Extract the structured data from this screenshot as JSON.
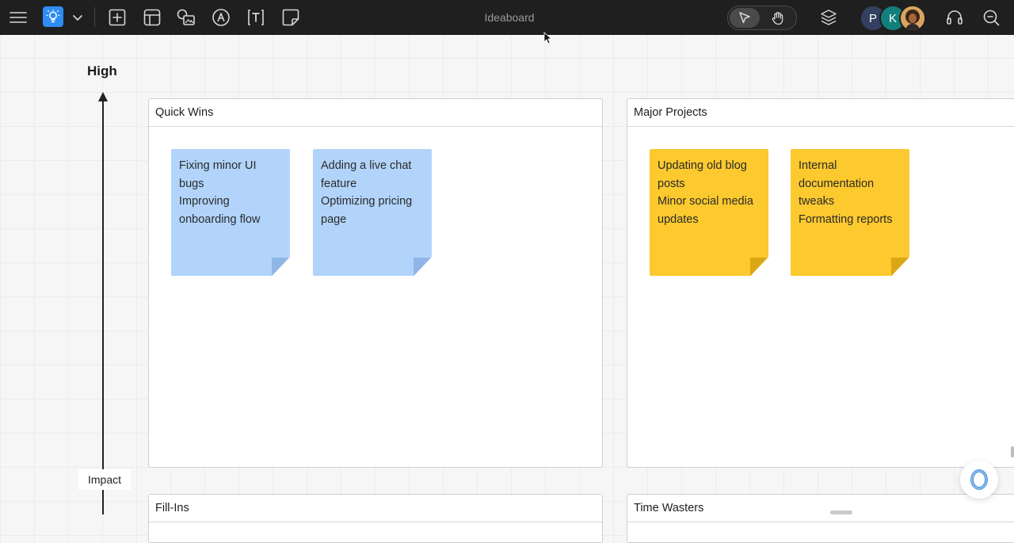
{
  "toolbar": {
    "title": "Ideaboard",
    "icons": [
      "menu-icon",
      "lightbulb-icon",
      "chevron-down-icon",
      "add-frame-icon",
      "layout-icon",
      "image-shapes-icon",
      "pen-circle-icon",
      "text-box-icon",
      "sticky-note-icon",
      "pointer-icon",
      "hand-icon",
      "layers-icon",
      "headset-icon",
      "search-zoom-icon"
    ],
    "avatars": [
      {
        "initial": "P",
        "color": "#34405f"
      },
      {
        "initial": "K",
        "color": "#127f7c"
      },
      {
        "initial": "",
        "color": "#c78a3a"
      }
    ],
    "accent": "#2f8cf3"
  },
  "axis": {
    "high_label": "High",
    "axis_name": "Impact"
  },
  "quadrants": [
    {
      "title": "Quick Wins",
      "notes": [
        {
          "lines": [
            "Fixing minor UI",
            "bugs",
            "Improving",
            "onboarding flow"
          ],
          "color": "#b2d4fb"
        },
        {
          "lines": [
            "Adding a live chat",
            "feature",
            "Optimizing pricing",
            "page"
          ],
          "color": "#b2d4fb"
        }
      ]
    },
    {
      "title": "Major Projects",
      "notes": [
        {
          "lines": [
            "Updating old blog",
            "posts",
            "Minor social media",
            "updates"
          ],
          "color": "#fcc92e"
        },
        {
          "lines": [
            "Internal",
            "documentation",
            "tweaks",
            "Formatting reports"
          ],
          "color": "#fcc92e"
        }
      ]
    },
    {
      "title": "Fill-Ins",
      "notes": []
    },
    {
      "title": "Time Wasters",
      "notes": []
    }
  ]
}
